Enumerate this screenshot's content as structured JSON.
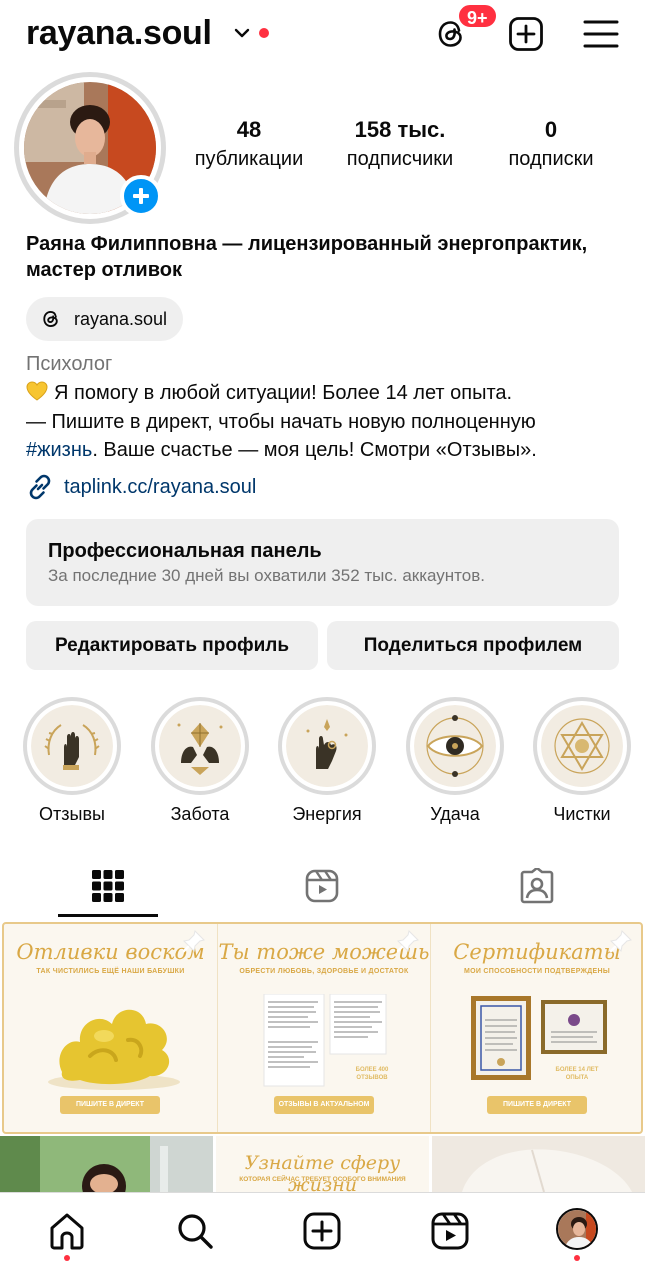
{
  "header": {
    "username": "rayana.soul",
    "notification_count": "9+",
    "accent_color": "#ff3040"
  },
  "stats": [
    {
      "value": "48",
      "label": "публикации"
    },
    {
      "value": "158 тыс.",
      "label": "подписчики"
    },
    {
      "value": "0",
      "label": "подписки"
    }
  ],
  "profile": {
    "full_name": "Раяна Филипповна — лицензированный энергопрактик, мастер отливок",
    "threads_handle": "rayana.soul",
    "category": "Психолог",
    "bio_line1": "Я помогу в любой ситуации! Более 14 лет опыта.",
    "bio_line2": "— Пишите в директ, чтобы начать новую полноценную",
    "bio_hashtag": "#жизнь",
    "bio_line3_rest": ". Ваше счастье — моя цель! Смотри «Отзывы».",
    "link": "taplink.cc/rayana.soul"
  },
  "dashboard": {
    "title": "Профессиональная панель",
    "subtitle": "За последние 30 дней вы охватили 352 тыс. аккаунтов."
  },
  "buttons": {
    "edit_profile": "Редактировать профиль",
    "share_profile": "Поделиться профилем"
  },
  "highlights": [
    {
      "label": "Отзывы",
      "icon": "laurel-hand-icon"
    },
    {
      "label": "Забота",
      "icon": "hands-crystal-icon"
    },
    {
      "label": "Энергия",
      "icon": "mudra-hand-icon"
    },
    {
      "label": "Удача",
      "icon": "eye-icon"
    },
    {
      "label": "Чистки",
      "icon": "star-of-david-icon"
    }
  ],
  "tabs": [
    {
      "name": "grid",
      "icon": "grid-icon",
      "active": true
    },
    {
      "name": "reels",
      "icon": "reels-icon",
      "active": false
    },
    {
      "name": "tagged",
      "icon": "tagged-icon",
      "active": false
    }
  ],
  "posts": [
    {
      "title": "Отливки воском",
      "subtitle": "ТАК ЧИСТИЛИСЬ ЕЩЁ НАШИ БАБУШКИ",
      "button": "ПИШИТЕ В ДИРЕКТ"
    },
    {
      "title": "Ты тоже можешь",
      "subtitle": "ОБРЕСТИ ЛЮБОВЬ, ЗДОРОВЬЕ И ДОСТАТОК",
      "badge": "БОЛЕЕ 400 ОТЗЫВОВ",
      "button": "ОТЗЫВЫ В АКТУАЛЬНОМ"
    },
    {
      "title": "Сертификаты",
      "subtitle": "МОИ СПОСОБНОСТИ ПОДТВЕРЖДЕНЫ",
      "badge": "БОЛЕЕ 14 ЛЕТ ОПЫТА",
      "button": "ПИШИТЕ В ДИРЕКТ"
    }
  ],
  "posts_row2": [
    {
      "title": ""
    },
    {
      "title": "Узнайте сферу жизни",
      "subtitle": "КОТОРАЯ СЕЙЧАС ТРЕБУЕТ ОСОБОГО ВНИМАНИЯ"
    },
    {
      "title": ""
    }
  ],
  "bottom_nav": [
    "home-icon",
    "search-icon",
    "create-icon",
    "reels-icon",
    "profile-avatar"
  ],
  "colors": {
    "link": "#00376b",
    "secondary_text": "#737373",
    "button_bg": "#efefef",
    "gold": "#d9a845",
    "blue": "#0095f6"
  }
}
